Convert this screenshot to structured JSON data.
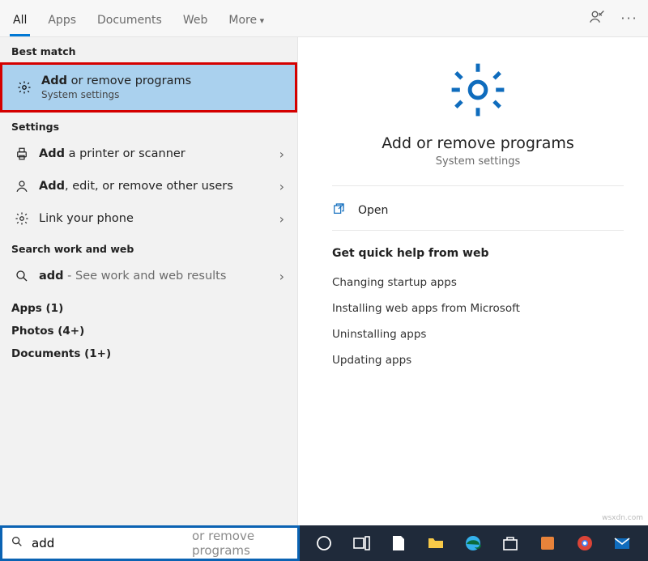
{
  "tabs": {
    "all": "All",
    "apps": "Apps",
    "documents": "Documents",
    "web": "Web",
    "more": "More"
  },
  "groups": {
    "best": "Best match",
    "settings": "Settings",
    "searchweb": "Search work and web"
  },
  "best_match": {
    "title_bold": "Add",
    "title_rest": " or remove programs",
    "subtitle": "System settings"
  },
  "settings_items": [
    {
      "bold": "Add",
      "rest": " a printer or scanner"
    },
    {
      "bold": "Add",
      "rest": ", edit, or remove other users"
    },
    {
      "plain": "Link your phone"
    }
  ],
  "web_item": {
    "bold": "add",
    "rest": " - See work and web results"
  },
  "cats": {
    "apps": "Apps (1)",
    "photos": "Photos (4+)",
    "docs": "Documents (1+)"
  },
  "hero": {
    "title": "Add or remove programs",
    "sub": "System settings"
  },
  "action_open": "Open",
  "quick": {
    "heading": "Get quick help from web",
    "links": [
      "Changing startup apps",
      "Installing web apps from Microsoft",
      "Uninstalling apps",
      "Updating apps"
    ]
  },
  "search": {
    "value": "add",
    "placeholder": "or remove programs"
  },
  "watermark": "wsxdn.com"
}
